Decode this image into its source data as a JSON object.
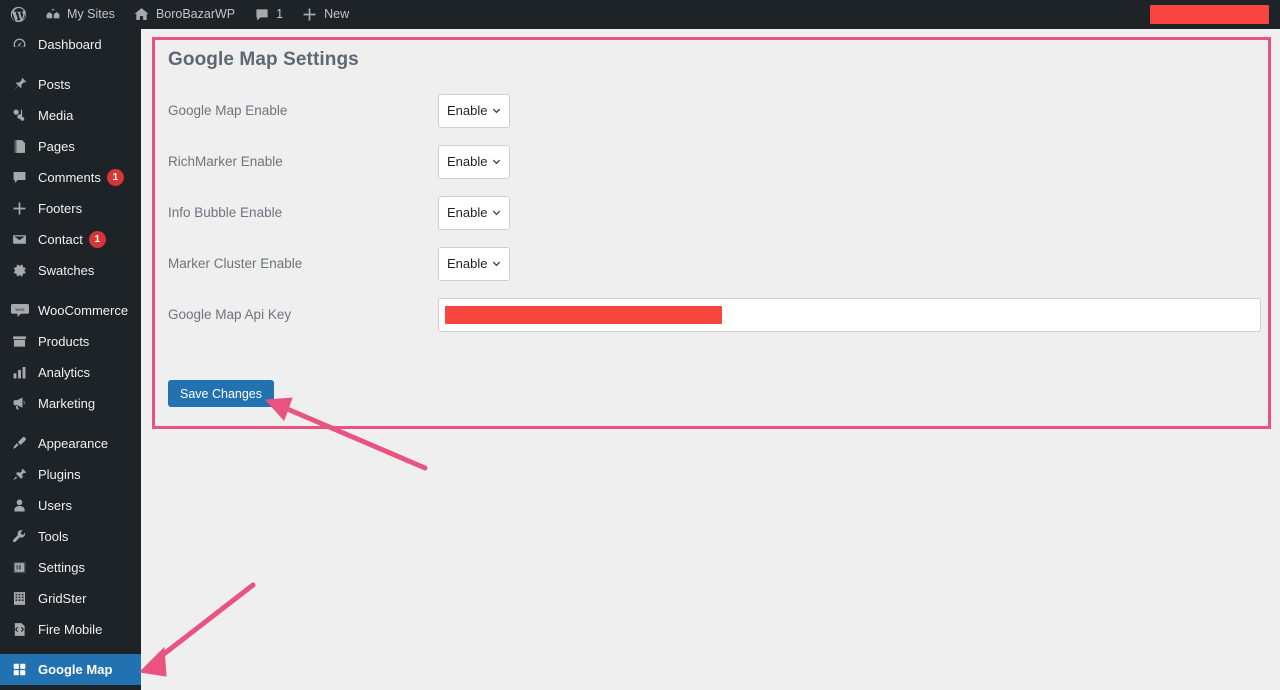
{
  "adminbar": {
    "items": [
      {
        "icon": "wordpress-logo-icon",
        "label": ""
      },
      {
        "icon": "my-sites-icon",
        "label": "My Sites"
      },
      {
        "icon": "home-icon",
        "label": "BoroBazarWP"
      },
      {
        "icon": "comment-bubble-icon",
        "label": "1"
      },
      {
        "icon": "plus-icon",
        "label": "New"
      }
    ],
    "redacted_account": ""
  },
  "sidebar": {
    "items": [
      {
        "icon": "dashboard-icon",
        "label": "Dashboard",
        "badge": "",
        "current": false,
        "sep_after": true
      },
      {
        "icon": "posts-pin-icon",
        "label": "Posts",
        "badge": "",
        "current": false,
        "sep_after": false
      },
      {
        "icon": "media-icon",
        "label": "Media",
        "badge": "",
        "current": false,
        "sep_after": false
      },
      {
        "icon": "pages-icon",
        "label": "Pages",
        "badge": "",
        "current": false,
        "sep_after": false
      },
      {
        "icon": "comments-icon",
        "label": "Comments",
        "badge": "1",
        "current": false,
        "sep_after": false
      },
      {
        "icon": "footers-plus-icon",
        "label": "Footers",
        "badge": "",
        "current": false,
        "sep_after": false
      },
      {
        "icon": "contact-envelope-icon",
        "label": "Contact",
        "badge": "1",
        "current": false,
        "sep_after": false
      },
      {
        "icon": "swatches-gear-icon",
        "label": "Swatches",
        "badge": "",
        "current": false,
        "sep_after": true
      },
      {
        "icon": "woocommerce-icon",
        "label": "WooCommerce",
        "badge": "",
        "current": false,
        "sep_after": false
      },
      {
        "icon": "products-box-icon",
        "label": "Products",
        "badge": "",
        "current": false,
        "sep_after": false
      },
      {
        "icon": "analytics-bars-icon",
        "label": "Analytics",
        "badge": "",
        "current": false,
        "sep_after": false
      },
      {
        "icon": "marketing-megaphone-icon",
        "label": "Marketing",
        "badge": "",
        "current": false,
        "sep_after": true
      },
      {
        "icon": "appearance-brush-icon",
        "label": "Appearance",
        "badge": "",
        "current": false,
        "sep_after": false
      },
      {
        "icon": "plugins-plug-icon",
        "label": "Plugins",
        "badge": "",
        "current": false,
        "sep_after": false
      },
      {
        "icon": "users-icon",
        "label": "Users",
        "badge": "",
        "current": false,
        "sep_after": false
      },
      {
        "icon": "tools-wrench-icon",
        "label": "Tools",
        "badge": "",
        "current": false,
        "sep_after": false
      },
      {
        "icon": "settings-sliders-icon",
        "label": "Settings",
        "badge": "",
        "current": false,
        "sep_after": false
      },
      {
        "icon": "gridster-icon",
        "label": "GridSter",
        "badge": "",
        "current": false,
        "sep_after": false
      },
      {
        "icon": "fire-mobile-code-icon",
        "label": "Fire Mobile",
        "badge": "",
        "current": false,
        "sep_after": true
      },
      {
        "icon": "google-map-grid-icon",
        "label": "Google Map",
        "badge": "",
        "current": true,
        "sep_after": false
      }
    ]
  },
  "main": {
    "title": "Google Map Settings",
    "fields": [
      {
        "label": "Google Map Enable",
        "type": "select",
        "value": "Enable"
      },
      {
        "label": "RichMarker Enable",
        "type": "select",
        "value": "Enable"
      },
      {
        "label": "Info Bubble Enable",
        "type": "select",
        "value": "Enable"
      },
      {
        "label": "Marker Cluster Enable",
        "type": "select",
        "value": "Enable"
      },
      {
        "label": "Google Map Api Key",
        "type": "text",
        "value": "",
        "placeholder": ""
      }
    ],
    "save_label": "Save Changes"
  },
  "colors": {
    "admin_dark": "#1d2327",
    "accent_blue": "#2271b1",
    "annotation_pink": "#e8547f",
    "redaction_red": "#f9453f",
    "badge_red": "#d63638",
    "page_bg": "#efefef"
  }
}
